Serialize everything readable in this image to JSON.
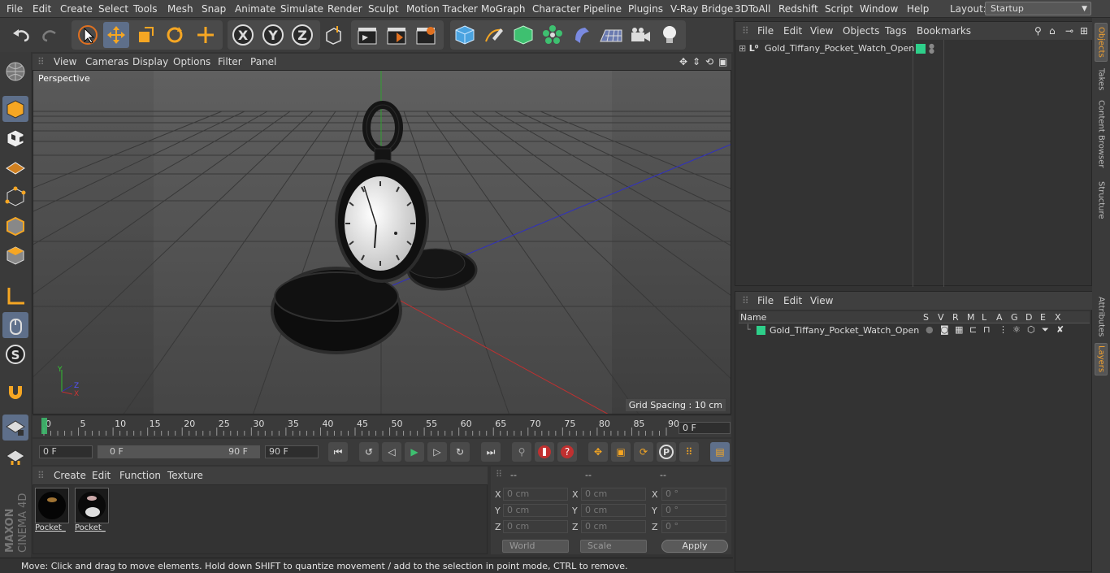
{
  "menubar": {
    "items": [
      "File",
      "Edit",
      "Create",
      "Select",
      "Tools",
      "Mesh",
      "Snap",
      "Animate",
      "Simulate",
      "Render",
      "Sculpt",
      "Motion Tracker",
      "MoGraph",
      "Character",
      "Pipeline",
      "Plugins",
      "V-Ray Bridge",
      "3DToAll",
      "Redshift",
      "Script",
      "Window",
      "Help"
    ],
    "layout_label": "Layout:",
    "layout_value": "Startup"
  },
  "viewport": {
    "menu": [
      "View",
      "Cameras",
      "Display",
      "Options",
      "Filter",
      "Panel"
    ],
    "label": "Perspective",
    "grid_spacing": "Grid Spacing : 10 cm"
  },
  "timeline": {
    "ticks": [
      "0",
      "5",
      "10",
      "15",
      "20",
      "25",
      "30",
      "35",
      "40",
      "45",
      "50",
      "55",
      "60",
      "65",
      "70",
      "75",
      "80",
      "85",
      "90"
    ],
    "current_frame": "0 F"
  },
  "transport": {
    "start": "0 F",
    "range_start": "0 F",
    "range_end": "90 F",
    "end": "90 F"
  },
  "materials": {
    "menu": [
      "Create",
      "Edit",
      "Function",
      "Texture"
    ],
    "items": [
      {
        "label": "Pocket_"
      },
      {
        "label": "Pocket_"
      }
    ]
  },
  "coords": {
    "headers": [
      "--",
      "--",
      "--"
    ],
    "axes": [
      "X",
      "Y",
      "Z"
    ],
    "pos": [
      "0 cm",
      "0 cm",
      "0 cm"
    ],
    "size": [
      "0 cm",
      "0 cm",
      "0 cm"
    ],
    "rot": [
      "0 °",
      "0 °",
      "0 °"
    ],
    "mode": "World",
    "measure": "Scale",
    "apply": "Apply"
  },
  "status": "Move: Click and drag to move elements. Hold down SHIFT to quantize movement / add to the selection in point mode, CTRL to remove.",
  "objects": {
    "menu": [
      "File",
      "Edit",
      "View",
      "Objects",
      "Tags",
      "Bookmarks"
    ],
    "name": "Gold_Tiffany_Pocket_Watch_Open"
  },
  "layers": {
    "menu": [
      "File",
      "Edit",
      "View"
    ],
    "columns": [
      "Name",
      "S",
      "V",
      "R",
      "M",
      "L",
      "A",
      "G",
      "D",
      "E",
      "X"
    ],
    "name": "Gold_Tiffany_Pocket_Watch_Open"
  },
  "sidetabs": [
    "Objects",
    "Takes",
    "Content Browser",
    "Structure",
    "Attributes",
    "Layers"
  ],
  "logo": {
    "brand": "MAXON",
    "product": "CINEMA 4D"
  },
  "colors": {
    "accent": "#f0a030",
    "layer": "#2ecf8a",
    "axis_x": "#c03030",
    "axis_y": "#30c030",
    "axis_z": "#3030c0"
  }
}
